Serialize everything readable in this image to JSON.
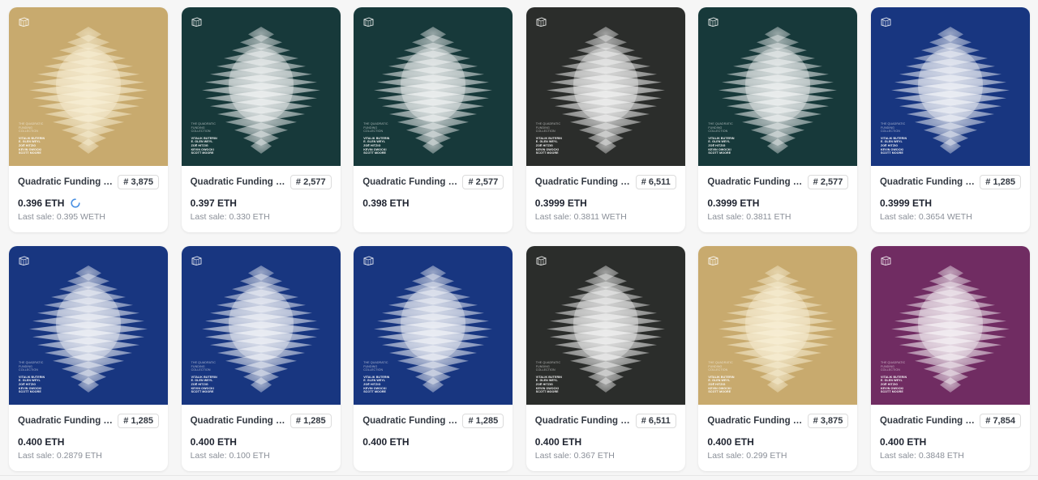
{
  "art_text": {
    "collection": [
      "The Quadratic",
      "Funding",
      "Collection"
    ],
    "authors": [
      "Vitalik Buterin",
      "E. Glen Weyl",
      "Zoë Hitzig",
      "Kevin Owocki",
      "Scott Moore"
    ]
  },
  "cards": [
    {
      "name": "Quadratic Funding O...",
      "token": "# 3,875",
      "price": "0.396 ETH",
      "last_sale": "Last sale: 0.395 WETH",
      "bg": "#c8aa6e",
      "tint": "#fbf4dc",
      "loading": true,
      "icon": "loading-spinner-icon"
    },
    {
      "name": "Quadratic Funding O...",
      "token": "# 2,577",
      "price": "0.397 ETH",
      "last_sale": "Last sale: 0.330 ETH",
      "bg": "#17393a",
      "tint": "#ffffff",
      "loading": false
    },
    {
      "name": "Quadratic Funding O...",
      "token": "# 2,577",
      "price": "0.398 ETH",
      "last_sale": "",
      "bg": "#17393a",
      "tint": "#ffffff",
      "loading": false
    },
    {
      "name": "Quadratic Funding Op...",
      "token": "# 6,511",
      "price": "0.3999 ETH",
      "last_sale": "Last sale: 0.3811 WETH",
      "bg": "#2b2d2b",
      "tint": "#ffffff",
      "loading": false
    },
    {
      "name": "Quadratic Funding O...",
      "token": "# 2,577",
      "price": "0.3999 ETH",
      "last_sale": "Last sale: 0.3811 ETH",
      "bg": "#17393a",
      "tint": "#ffffff",
      "loading": false
    },
    {
      "name": "Quadratic Funding O...",
      "token": "# 1,285",
      "price": "0.3999 ETH",
      "last_sale": "Last sale: 0.3654 WETH",
      "bg": "#183680",
      "tint": "#ffffff",
      "loading": false
    },
    {
      "name": "Quadratic Funding O...",
      "token": "# 1,285",
      "price": "0.400 ETH",
      "last_sale": "Last sale: 0.2879 ETH",
      "bg": "#183680",
      "tint": "#ffffff",
      "loading": false
    },
    {
      "name": "Quadratic Funding O...",
      "token": "# 1,285",
      "price": "0.400 ETH",
      "last_sale": "Last sale: 0.100 ETH",
      "bg": "#183680",
      "tint": "#ffffff",
      "loading": false
    },
    {
      "name": "Quadratic Funding O...",
      "token": "# 1,285",
      "price": "0.400 ETH",
      "last_sale": "",
      "bg": "#183680",
      "tint": "#ffffff",
      "loading": false
    },
    {
      "name": "Quadratic Funding Op...",
      "token": "# 6,511",
      "price": "0.400 ETH",
      "last_sale": "Last sale: 0.367 ETH",
      "bg": "#2b2d2b",
      "tint": "#ffffff",
      "loading": false
    },
    {
      "name": "Quadratic Funding O...",
      "token": "# 3,875",
      "price": "0.400 ETH",
      "last_sale": "Last sale: 0.299 ETH",
      "bg": "#c8aa6e",
      "tint": "#fbf4dc",
      "loading": false
    },
    {
      "name": "Quadratic Funding O...",
      "token": "# 7,854",
      "price": "0.400 ETH",
      "last_sale": "Last sale: 0.3848 ETH",
      "bg": "#702c62",
      "tint": "#ffffff",
      "loading": false
    }
  ]
}
